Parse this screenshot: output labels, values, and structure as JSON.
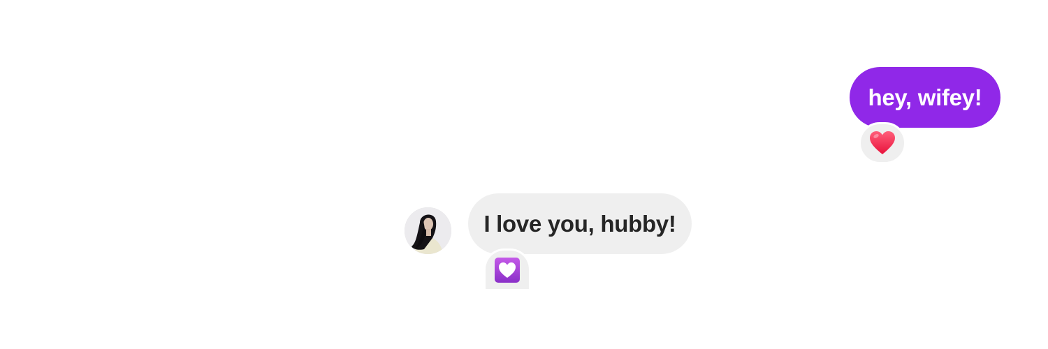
{
  "messages": [
    {
      "direction": "outgoing",
      "text": "hey, wifey!",
      "bubble_color": "#9028e8",
      "reaction": {
        "icon": "red-heart-icon",
        "color": "#f0344f"
      }
    },
    {
      "direction": "incoming",
      "text": "I love you, hubby!",
      "bubble_color": "#efefef",
      "avatar": "contact-avatar",
      "reaction": {
        "icon": "heart-decoration-icon",
        "color": "#a43bd8"
      }
    }
  ]
}
